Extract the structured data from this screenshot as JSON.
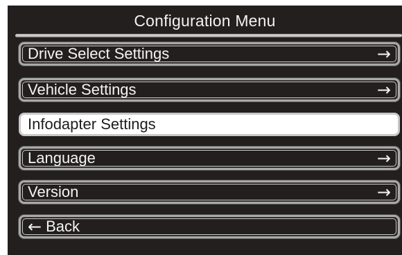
{
  "title": "Configuration Menu",
  "menu": {
    "items": [
      {
        "label": "Drive Select Settings",
        "arrow": "→"
      },
      {
        "label": "Vehicle Settings",
        "arrow": "→"
      },
      {
        "label": "Infodapter Settings",
        "selected": true
      },
      {
        "label": "Language",
        "arrow": "→"
      },
      {
        "label": "Version",
        "arrow": "→"
      }
    ],
    "back": {
      "icon": "←",
      "label": "Back"
    }
  },
  "colors": {
    "background": "#231f1f",
    "selected_background": "#ffffff",
    "border": "#a9a9a9",
    "text": "#f4f4f4"
  },
  "icons": {
    "item_arrow": "arrow-right-icon",
    "back_arrow": "arrow-left-icon"
  }
}
